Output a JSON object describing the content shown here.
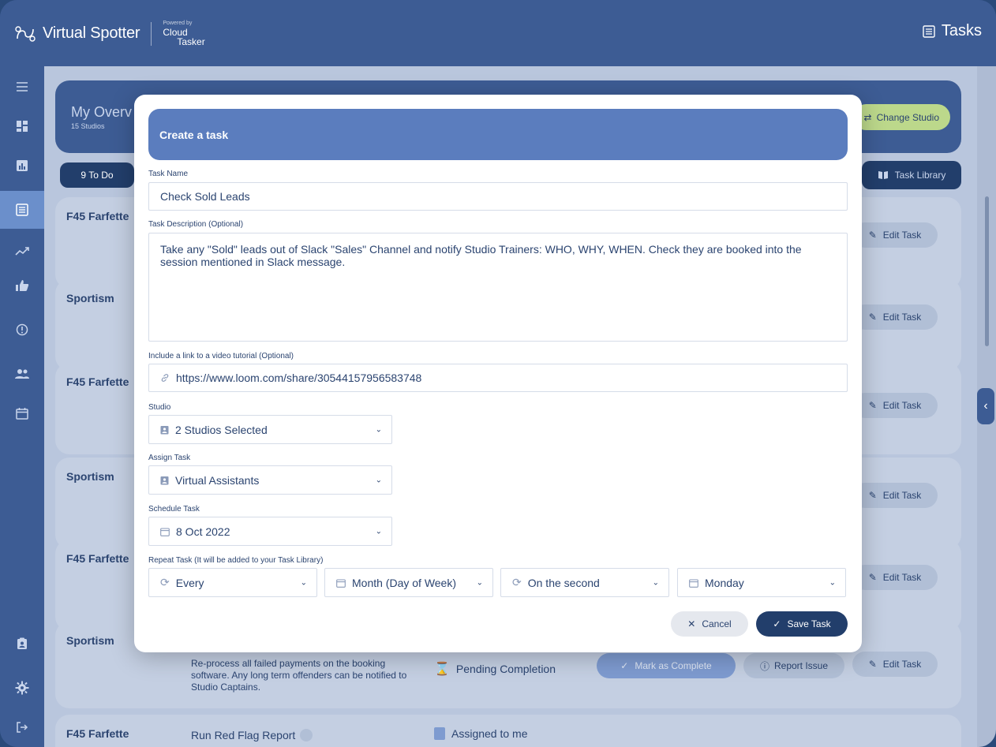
{
  "app": {
    "brand_name": "Virtual Spotter",
    "powered_by": "Powered by",
    "partner_line1": "Cloud",
    "partner_line2": "Tasker",
    "section_title": "Tasks"
  },
  "overview": {
    "title": "My Overv",
    "subtitle": "15 Studios",
    "change_studio_label": "Change Studio"
  },
  "toolbar": {
    "todo_label": "9 To Do",
    "task_library_label": "Task Library"
  },
  "rows": [
    {
      "studio": "F45 Farfette",
      "edit_label": "Edit Task"
    },
    {
      "studio": "Sportism",
      "edit_label": "Edit Task"
    },
    {
      "studio": "F45 Farfette",
      "edit_label": "Edit Task"
    },
    {
      "studio": "Sportism",
      "edit_label": "Edit Task"
    },
    {
      "studio": "F45 Farfette",
      "edit_label": "Edit Task"
    },
    {
      "studio": "Sportism",
      "description": "Re-process all failed payments on the booking software. Any long term offenders can be notified to Studio Captains.",
      "status": "Pending Completion",
      "mark_label": "Mark as Complete",
      "report_label": "Report Issue",
      "edit_label": "Edit Task"
    },
    {
      "studio": "F45 Farfette",
      "title": "Run Red Flag Report",
      "status": "Assigned to me"
    }
  ],
  "modal": {
    "title": "Create a task",
    "task_name_label": "Task Name",
    "task_name_value": "Check Sold Leads",
    "description_label": "Task Description (Optional)",
    "description_value": "Take any \"Sold\" leads out of Slack \"Sales\" Channel and notify Studio Trainers: WHO, WHY, WHEN. Check they are booked into the session mentioned in Slack message.",
    "video_label": "Include a link to a video tutorial (Optional)",
    "video_value": "https://www.loom.com/share/30544157956583748",
    "studio_label": "Studio",
    "studio_value": "2 Studios Selected",
    "assign_label": "Assign Task",
    "assign_value": "Virtual Assistants",
    "schedule_label": "Schedule Task",
    "schedule_value": "8 Oct 2022",
    "repeat_label": "Repeat Task (It will be added to your Task Library)",
    "repeat_every": "Every",
    "repeat_unit": "Month (Day of Week)",
    "repeat_ordinal": "On the second",
    "repeat_day": "Monday",
    "cancel_label": "Cancel",
    "save_label": "Save Task"
  },
  "icons": {
    "menu": "menu-icon",
    "dashboard": "dashboard-icon",
    "chart": "bar-chart-icon",
    "tasks": "task-list-icon",
    "trend": "trend-icon",
    "thumbs": "thumbs-up-icon",
    "alert": "alert-circle-icon",
    "people": "people-icon",
    "calendar": "calendar-icon",
    "clipboard": "clipboard-user-icon",
    "settings": "gear-icon",
    "logout": "logout-icon"
  },
  "colors": {
    "brand": "#3d5c94",
    "modal_header": "#5b7dbe",
    "primary_dark": "#223e6b",
    "accent_green": "#bcd88b"
  }
}
